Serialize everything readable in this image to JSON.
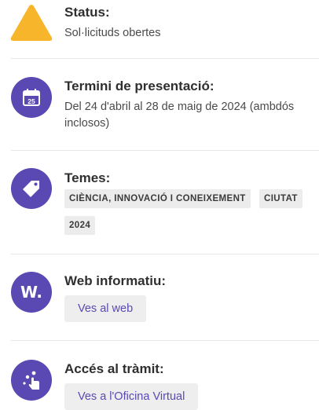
{
  "status": {
    "title": "Status:",
    "value": "Sol·licituds obertes",
    "icon": "warning-triangle-icon",
    "color": "#f7b52b"
  },
  "deadline": {
    "title": "Termini de presentació:",
    "value": "Del 24 d'abril al 28 de maig de 2024 (ambdós inclosos)",
    "icon": "calendar-icon",
    "icon_day": "25"
  },
  "topics": {
    "title": "Temes:",
    "icon": "tag-icon",
    "tags": [
      "CIÈNCIA, INNOVACIÓ I CONEIXEMENT",
      "CIUTAT",
      "2024"
    ]
  },
  "website": {
    "title": "Web informatiu:",
    "icon": "w-logo-icon",
    "icon_text": "W.",
    "button": "Ves al web"
  },
  "procedure": {
    "title": "Accés al tràmit:",
    "icon": "touch-access-icon",
    "button": "Ves a l'Oficina Virtual"
  },
  "accent_color": "#5b49b3"
}
